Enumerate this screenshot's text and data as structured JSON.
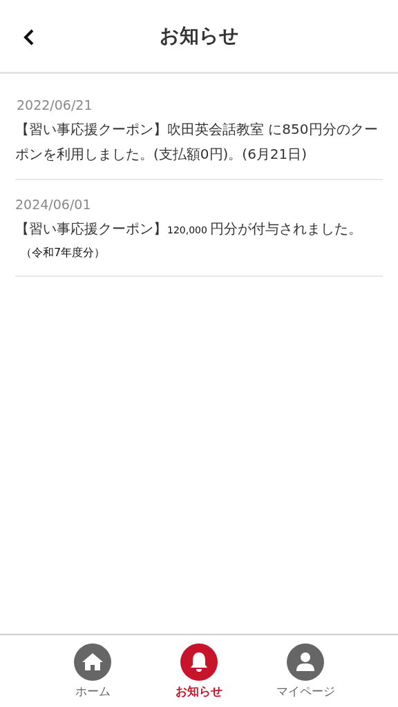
{
  "header": {
    "title": "お知らせ"
  },
  "notices": [
    {
      "date": "2022/06/21",
      "message": [
        {
          "kind": "normal",
          "text": "【習い事応援クーポン】吹田英会話教室 に850円分のクーポンを利用しました。(支払額0円)。(6月21日)"
        }
      ]
    },
    {
      "date": "2024/06/01",
      "message": [
        {
          "kind": "normal",
          "text": "【習い事応援クーポン】"
        },
        {
          "kind": "small",
          "text": "120,000 "
        },
        {
          "kind": "normal",
          "text": "円分が付与されました。"
        }
      ],
      "note": "（令和7年度分）"
    }
  ],
  "nav": [
    {
      "kind": "home",
      "label": "ホーム",
      "selected": false
    },
    {
      "kind": "bell",
      "label": "お知らせ",
      "selected": true
    },
    {
      "kind": "person",
      "label": "マイページ",
      "selected": false
    }
  ]
}
